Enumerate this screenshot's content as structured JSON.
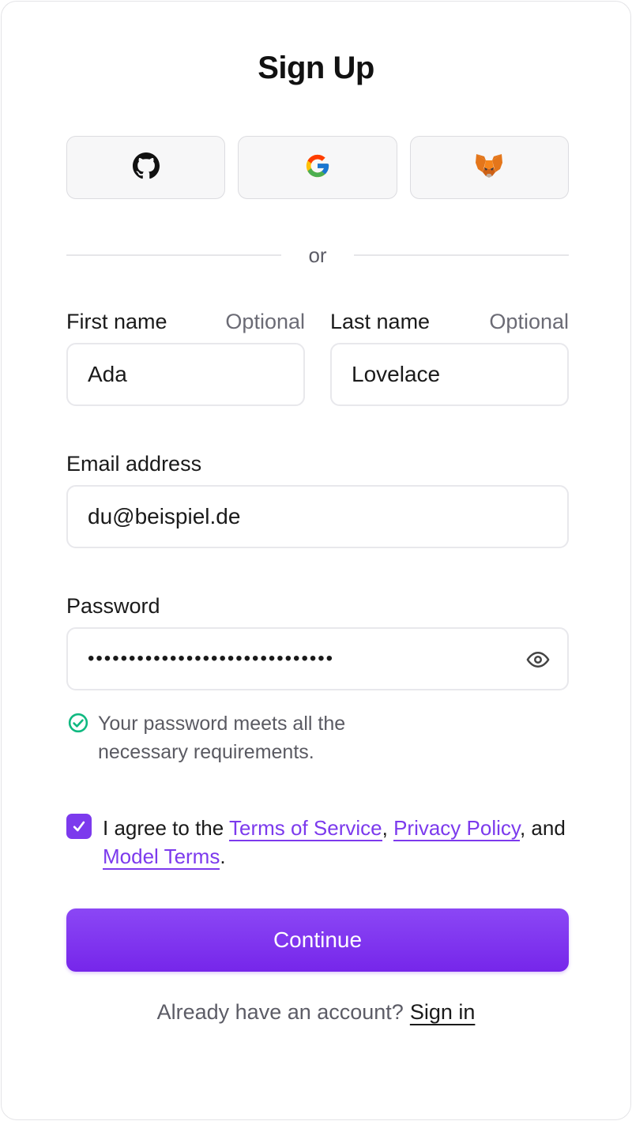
{
  "title": "Sign Up",
  "social": [
    {
      "provider": "GitHub",
      "icon": "github-icon"
    },
    {
      "provider": "Google",
      "icon": "google-icon"
    },
    {
      "provider": "MetaMask",
      "icon": "metamask-fox-icon"
    }
  ],
  "divider_text": "or",
  "first_name": {
    "label": "First name",
    "optional": "Optional",
    "value": "Ada"
  },
  "last_name": {
    "label": "Last name",
    "optional": "Optional",
    "value": "Lovelace"
  },
  "email": {
    "label": "Email address",
    "value": "du@beispiel.de"
  },
  "password": {
    "label": "Password",
    "value_masked": "••••••••••••••••••••••••••••••"
  },
  "password_note": "Your password meets all the necessary requirements.",
  "agreement": {
    "prefix": "I agree to the ",
    "terms_link": "Terms of Service",
    "comma": ",",
    "privacy_link": "Privacy Policy",
    "and": ", and ",
    "model_link": "Model Terms",
    "suffix": ".",
    "checked": true
  },
  "continue_label": "Continue",
  "footer": {
    "text": "Already have an account?",
    "link": "Sign in"
  },
  "colors": {
    "accent": "#7c3aed",
    "success": "#10b981"
  }
}
